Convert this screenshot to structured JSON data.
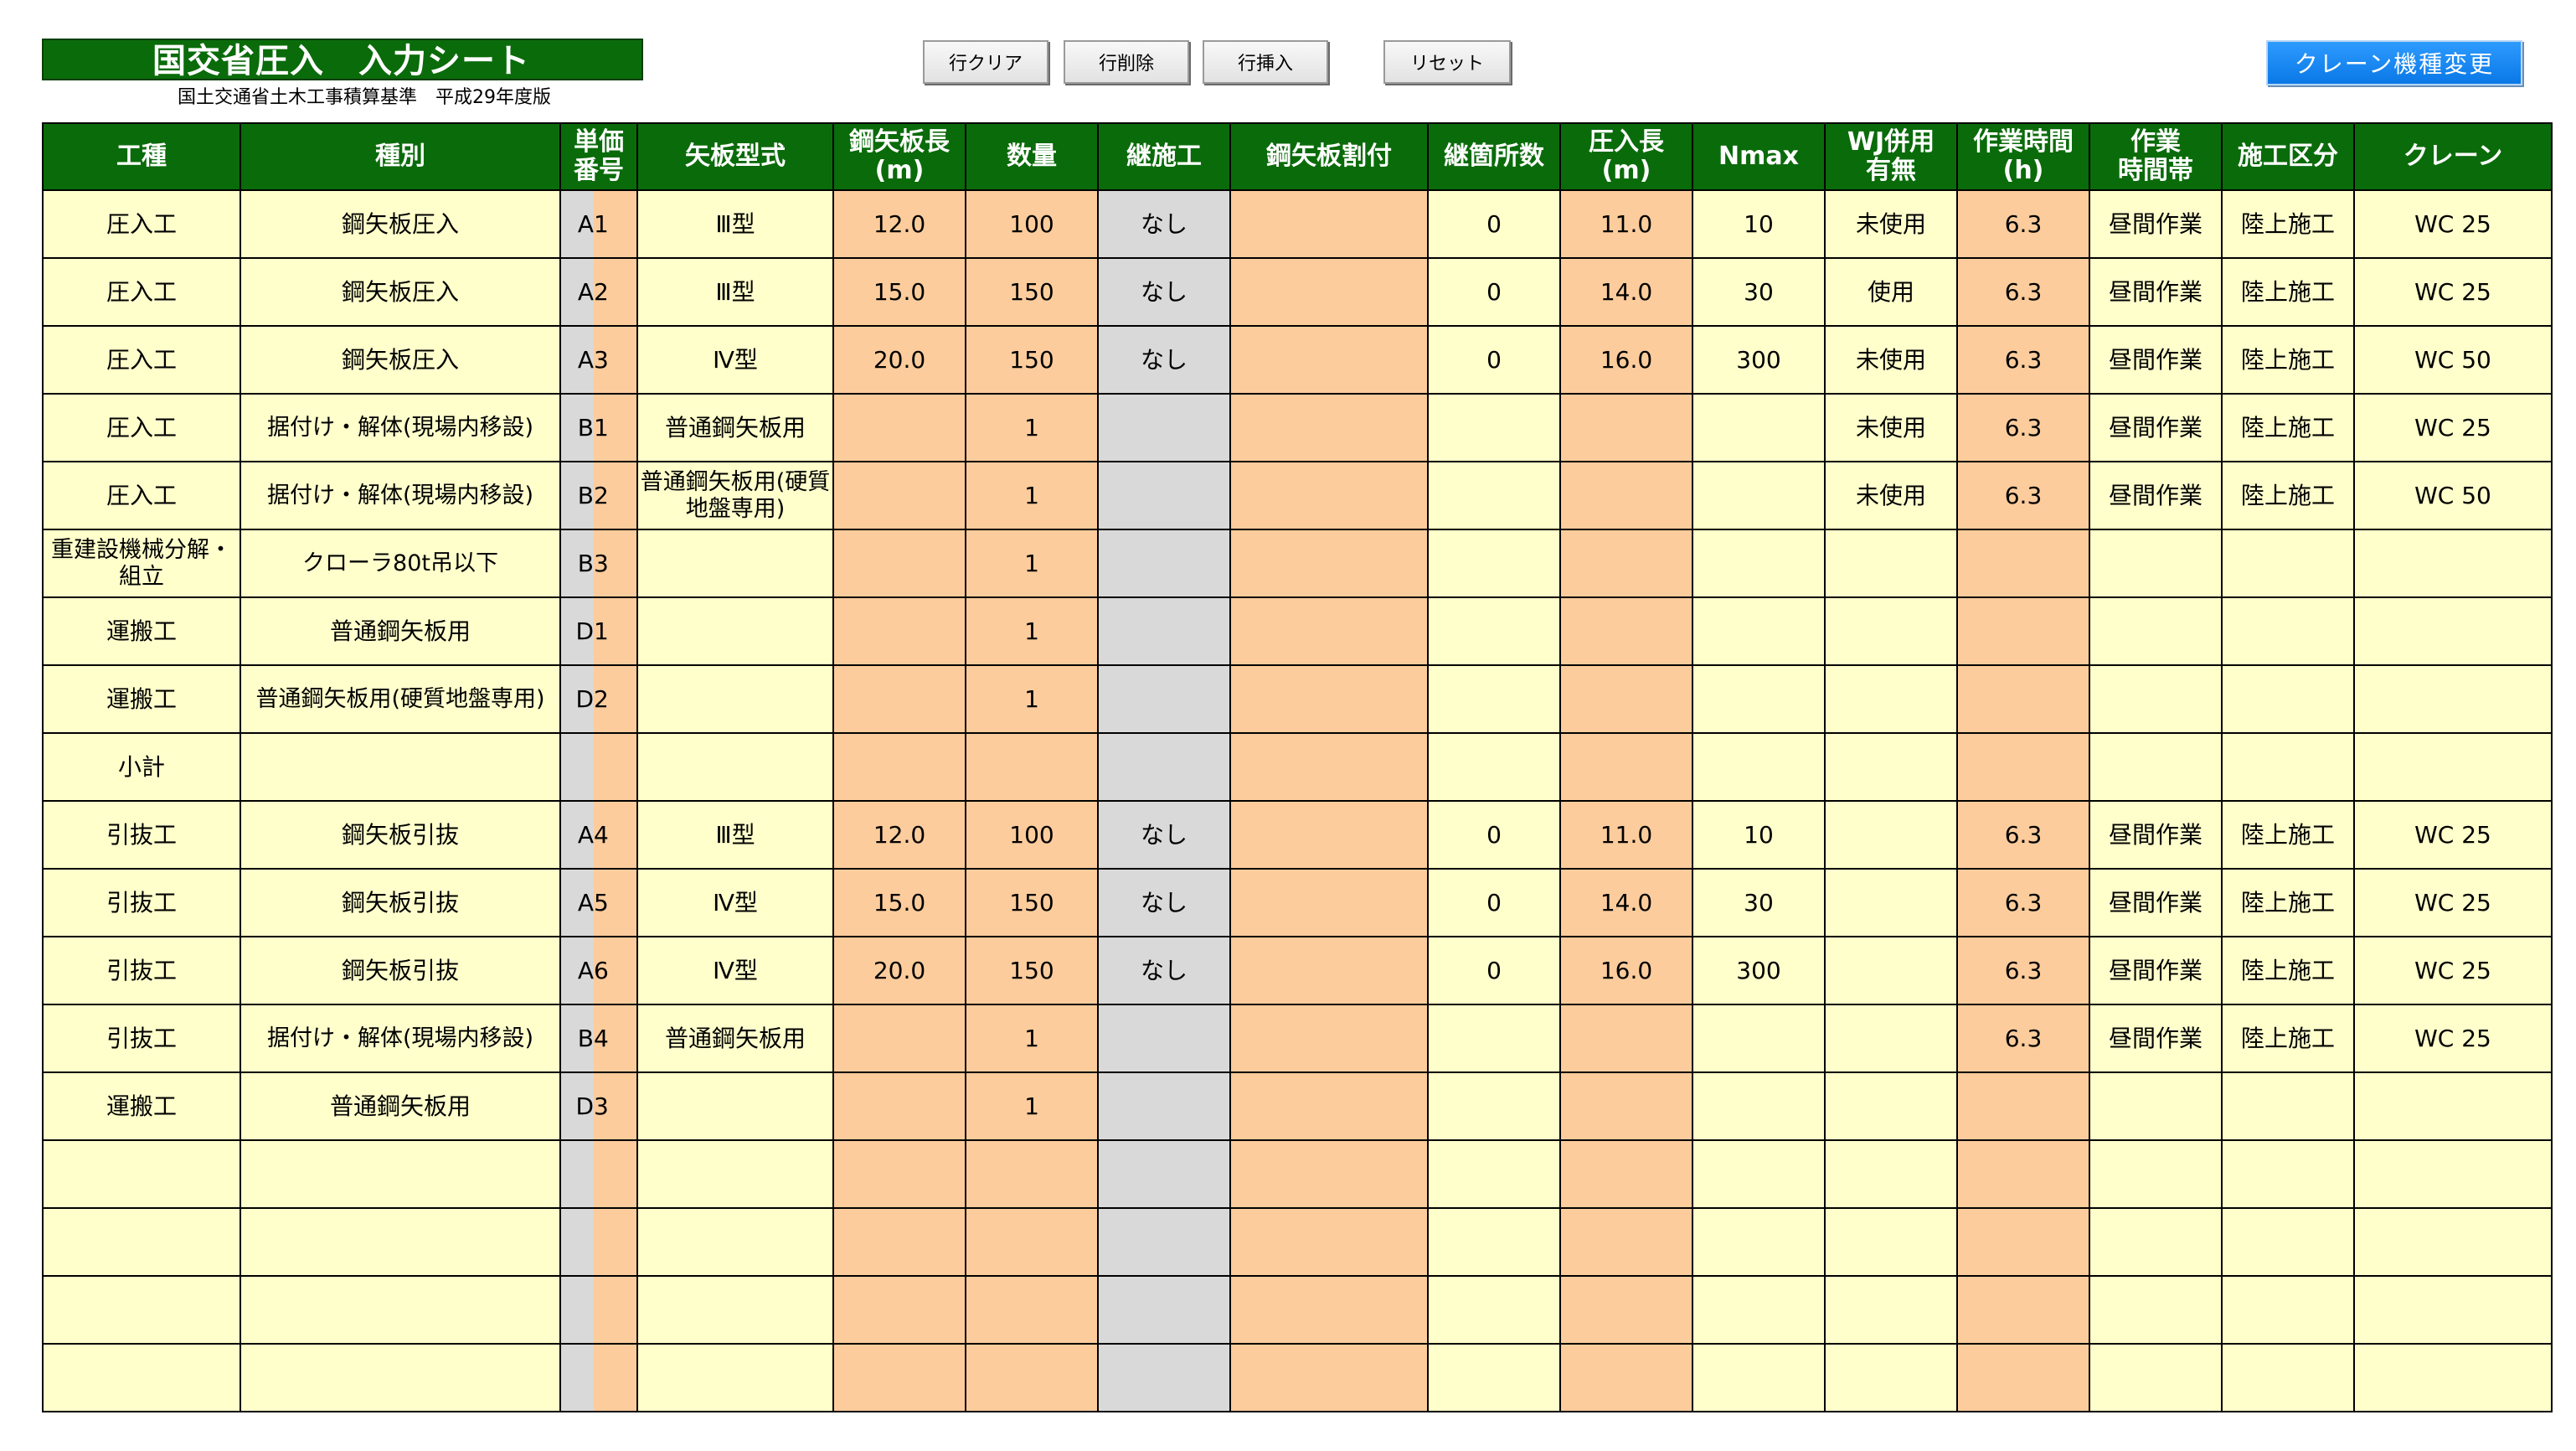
{
  "sheet": {
    "title": "国交省圧入　入力シート",
    "subtitle": "国土交通省土木工事積算基準　平成29年度版"
  },
  "toolbar": {
    "row_clear": "行クリア",
    "row_delete": "行削除",
    "row_insert": "行挿入",
    "reset": "リセット",
    "crane_change": "クレーン機種変更"
  },
  "table": {
    "headers": [
      "工種",
      "種別",
      "単価\n番号",
      "矢板型式",
      "鋼矢板長\n(m)",
      "数量",
      "継施工",
      "鋼矢板割付",
      "継箇所数",
      "圧入長\n(m)",
      "Nmax",
      "WJ併用\n有無",
      "作業時間\n(h)",
      "作業\n時間帯",
      "施工区分",
      "クレーン"
    ],
    "rows": [
      {
        "kind": "圧入工",
        "type": "鋼矢板圧入",
        "code_letter": "A",
        "code_num": "1",
        "model": "Ⅲ型",
        "length": "12.0",
        "qty": "100",
        "joint": "なし",
        "layout": "",
        "joint_count": "0",
        "press_len": "11.0",
        "nmax": "10",
        "wj": "未使用",
        "hours": "6.3",
        "period": "昼間作業",
        "section": "陸上施工",
        "crane": "WC 25"
      },
      {
        "kind": "圧入工",
        "type": "鋼矢板圧入",
        "code_letter": "A",
        "code_num": "2",
        "model": "Ⅲ型",
        "length": "15.0",
        "qty": "150",
        "joint": "なし",
        "layout": "",
        "joint_count": "0",
        "press_len": "14.0",
        "nmax": "30",
        "wj": "使用",
        "hours": "6.3",
        "period": "昼間作業",
        "section": "陸上施工",
        "crane": "WC 25"
      },
      {
        "kind": "圧入工",
        "type": "鋼矢板圧入",
        "code_letter": "A",
        "code_num": "3",
        "model": "Ⅳ型",
        "length": "20.0",
        "qty": "150",
        "joint": "なし",
        "layout": "",
        "joint_count": "0",
        "press_len": "16.0",
        "nmax": "300",
        "wj": "未使用",
        "hours": "6.3",
        "period": "昼間作業",
        "section": "陸上施工",
        "crane": "WC 50"
      },
      {
        "kind": "圧入工",
        "type": "据付け・解体(現場内移設)",
        "code_letter": "B",
        "code_num": "1",
        "model": "普通鋼矢板用",
        "length": "",
        "qty": "1",
        "joint": "",
        "layout": "",
        "joint_count": "",
        "press_len": "",
        "nmax": "",
        "wj": "未使用",
        "hours": "6.3",
        "period": "昼間作業",
        "section": "陸上施工",
        "crane": "WC 25"
      },
      {
        "kind": "圧入工",
        "type": "据付け・解体(現場内移設)",
        "code_letter": "B",
        "code_num": "2",
        "model": "普通鋼矢板用(硬質地盤専用)",
        "length": "",
        "qty": "1",
        "joint": "",
        "layout": "",
        "joint_count": "",
        "press_len": "",
        "nmax": "",
        "wj": "未使用",
        "hours": "6.3",
        "period": "昼間作業",
        "section": "陸上施工",
        "crane": "WC 50"
      },
      {
        "kind": "重建設機械分解・組立",
        "type": "クローラ80t吊以下",
        "code_letter": "B",
        "code_num": "3",
        "model": "",
        "length": "",
        "qty": "1",
        "joint": "",
        "layout": "",
        "joint_count": "",
        "press_len": "",
        "nmax": "",
        "wj": "",
        "hours": "",
        "period": "",
        "section": "",
        "crane": ""
      },
      {
        "kind": "運搬工",
        "type": "普通鋼矢板用",
        "code_letter": "D",
        "code_num": "1",
        "model": "",
        "length": "",
        "qty": "1",
        "joint": "",
        "layout": "",
        "joint_count": "",
        "press_len": "",
        "nmax": "",
        "wj": "",
        "hours": "",
        "period": "",
        "section": "",
        "crane": ""
      },
      {
        "kind": "運搬工",
        "type": "普通鋼矢板用(硬質地盤専用)",
        "code_letter": "D",
        "code_num": "2",
        "model": "",
        "length": "",
        "qty": "1",
        "joint": "",
        "layout": "",
        "joint_count": "",
        "press_len": "",
        "nmax": "",
        "wj": "",
        "hours": "",
        "period": "",
        "section": "",
        "crane": ""
      },
      {
        "kind": "小計",
        "type": "",
        "code_letter": "",
        "code_num": "",
        "model": "",
        "length": "",
        "qty": "",
        "joint": "",
        "layout": "",
        "joint_count": "",
        "press_len": "",
        "nmax": "",
        "wj": "",
        "hours": "",
        "period": "",
        "section": "",
        "crane": ""
      },
      {
        "kind": "引抜工",
        "type": "鋼矢板引抜",
        "code_letter": "A",
        "code_num": "4",
        "model": "Ⅲ型",
        "length": "12.0",
        "qty": "100",
        "joint": "なし",
        "layout": "",
        "joint_count": "0",
        "press_len": "11.0",
        "nmax": "10",
        "wj": "",
        "hours": "6.3",
        "period": "昼間作業",
        "section": "陸上施工",
        "crane": "WC 25"
      },
      {
        "kind": "引抜工",
        "type": "鋼矢板引抜",
        "code_letter": "A",
        "code_num": "5",
        "model": "Ⅳ型",
        "length": "15.0",
        "qty": "150",
        "joint": "なし",
        "layout": "",
        "joint_count": "0",
        "press_len": "14.0",
        "nmax": "30",
        "wj": "",
        "hours": "6.3",
        "period": "昼間作業",
        "section": "陸上施工",
        "crane": "WC 25"
      },
      {
        "kind": "引抜工",
        "type": "鋼矢板引抜",
        "code_letter": "A",
        "code_num": "6",
        "model": "Ⅳ型",
        "length": "20.0",
        "qty": "150",
        "joint": "なし",
        "layout": "",
        "joint_count": "0",
        "press_len": "16.0",
        "nmax": "300",
        "wj": "",
        "hours": "6.3",
        "period": "昼間作業",
        "section": "陸上施工",
        "crane": "WC 25"
      },
      {
        "kind": "引抜工",
        "type": "据付け・解体(現場内移設)",
        "code_letter": "B",
        "code_num": "4",
        "model": "普通鋼矢板用",
        "length": "",
        "qty": "1",
        "joint": "",
        "layout": "",
        "joint_count": "",
        "press_len": "",
        "nmax": "",
        "wj": "",
        "hours": "6.3",
        "period": "昼間作業",
        "section": "陸上施工",
        "crane": "WC 25"
      },
      {
        "kind": "運搬工",
        "type": "普通鋼矢板用",
        "code_letter": "D",
        "code_num": "3",
        "model": "",
        "length": "",
        "qty": "1",
        "joint": "",
        "layout": "",
        "joint_count": "",
        "press_len": "",
        "nmax": "",
        "wj": "",
        "hours": "",
        "period": "",
        "section": "",
        "crane": ""
      },
      {
        "kind": "",
        "type": "",
        "code_letter": "",
        "code_num": "",
        "model": "",
        "length": "",
        "qty": "",
        "joint": "",
        "layout": "",
        "joint_count": "",
        "press_len": "",
        "nmax": "",
        "wj": "",
        "hours": "",
        "period": "",
        "section": "",
        "crane": ""
      },
      {
        "kind": "",
        "type": "",
        "code_letter": "",
        "code_num": "",
        "model": "",
        "length": "",
        "qty": "",
        "joint": "",
        "layout": "",
        "joint_count": "",
        "press_len": "",
        "nmax": "",
        "wj": "",
        "hours": "",
        "period": "",
        "section": "",
        "crane": ""
      },
      {
        "kind": "",
        "type": "",
        "code_letter": "",
        "code_num": "",
        "model": "",
        "length": "",
        "qty": "",
        "joint": "",
        "layout": "",
        "joint_count": "",
        "press_len": "",
        "nmax": "",
        "wj": "",
        "hours": "",
        "period": "",
        "section": "",
        "crane": ""
      },
      {
        "kind": "",
        "type": "",
        "code_letter": "",
        "code_num": "",
        "model": "",
        "length": "",
        "qty": "",
        "joint": "",
        "layout": "",
        "joint_count": "",
        "press_len": "",
        "nmax": "",
        "wj": "",
        "hours": "",
        "period": "",
        "section": "",
        "crane": ""
      }
    ]
  },
  "colors": {
    "header_green": "#0a6b0a",
    "input_yellow": "#ffffcc",
    "input_orange": "#fccc9c",
    "locked_gray": "#d9d9d9",
    "button_blue": "#0a78e6"
  }
}
